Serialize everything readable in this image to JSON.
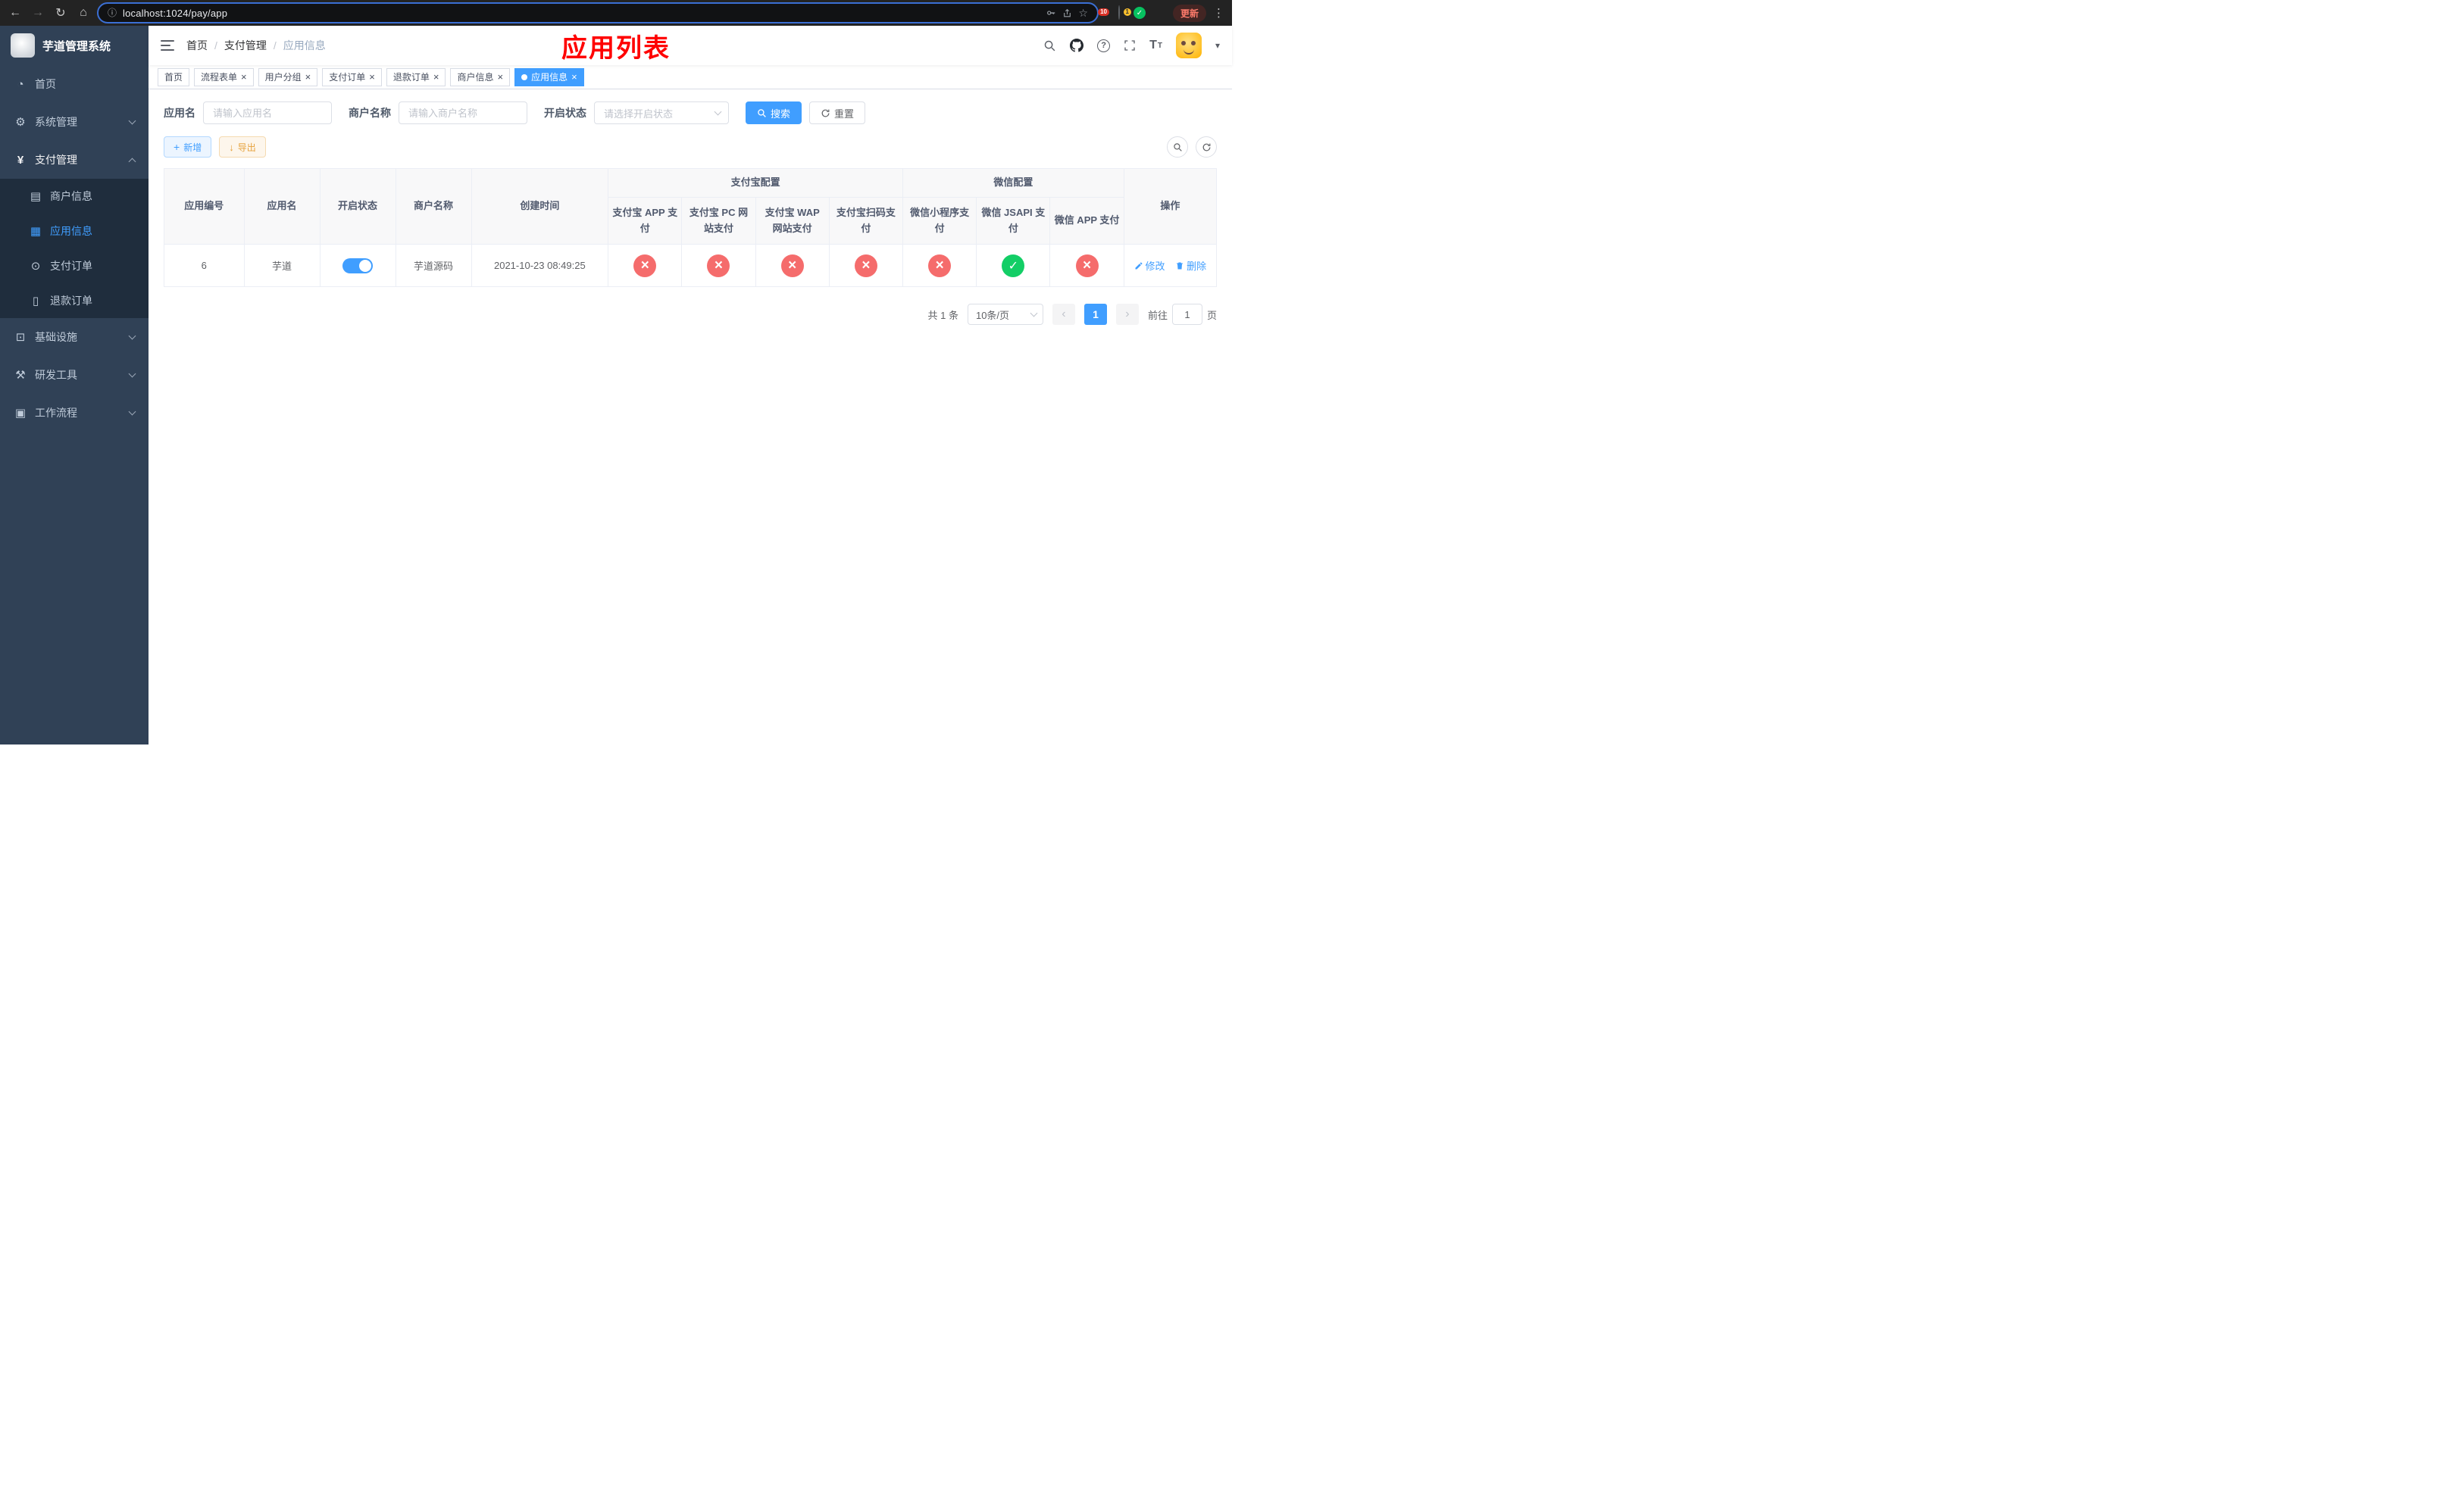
{
  "browser": {
    "url": "localhost:1024/pay/app",
    "update_label": "更新",
    "ext_badge_puzzle": "10",
    "ext_badge_avatar": "1"
  },
  "sidebar": {
    "app_title": "芋道管理系统",
    "home": "首页",
    "system": "系统管理",
    "payment": "支付管理",
    "payment_children": [
      "商户信息",
      "应用信息",
      "支付订单",
      "退款订单"
    ],
    "infra": "基础设施",
    "devtools": "研发工具",
    "workflow": "工作流程"
  },
  "header": {
    "breadcrumb": [
      "首页",
      "支付管理",
      "应用信息"
    ],
    "overlay_title": "应用列表"
  },
  "tabs": [
    {
      "label": "首页"
    },
    {
      "label": "流程表单"
    },
    {
      "label": "用户分组"
    },
    {
      "label": "支付订单"
    },
    {
      "label": "退款订单"
    },
    {
      "label": "商户信息"
    },
    {
      "label": "应用信息"
    }
  ],
  "filters": {
    "app_name_label": "应用名",
    "app_name_placeholder": "请输入应用名",
    "merchant_label": "商户名称",
    "merchant_placeholder": "请输入商户名称",
    "status_label": "开启状态",
    "status_placeholder": "请选择开启状态",
    "search_label": "搜索",
    "reset_label": "重置"
  },
  "toolbar": {
    "add_label": "新增",
    "export_label": "导出"
  },
  "table": {
    "col_id": "应用编号",
    "col_name": "应用名",
    "col_status": "开启状态",
    "col_merchant": "商户名称",
    "col_created": "创建时间",
    "col_op": "操作",
    "group_alipay": "支付宝配置",
    "group_wechat": "微信配置",
    "sub_cols": [
      "支付宝 APP 支付",
      "支付宝 PC 网站支付",
      "支付宝 WAP 网站支付",
      "支付宝扫码支付",
      "微信小程序支付",
      "微信 JSAPI 支付",
      "微信 APP 支付"
    ],
    "row": {
      "id": "6",
      "name": "芋道",
      "enabled": "true",
      "merchant": "芋道源码",
      "created": "2021-10-23 08:49:25",
      "statuses": [
        "fail",
        "fail",
        "fail",
        "fail",
        "fail",
        "success",
        "fail"
      ],
      "edit_label": "修改",
      "delete_label": "删除"
    }
  },
  "pagination": {
    "total": "共 1 条",
    "page_size": "10条/页",
    "page": "1",
    "goto_label": "前往",
    "goto_value": "1",
    "unit": "页"
  },
  "colors": {
    "primary": "#409eff",
    "success": "#13ce66",
    "danger": "#f56c6c",
    "warning": "#e6a23c",
    "annotation": "#ff0000",
    "sidebar_bg": "#304156",
    "submenu_bg": "#1f2d3d"
  }
}
